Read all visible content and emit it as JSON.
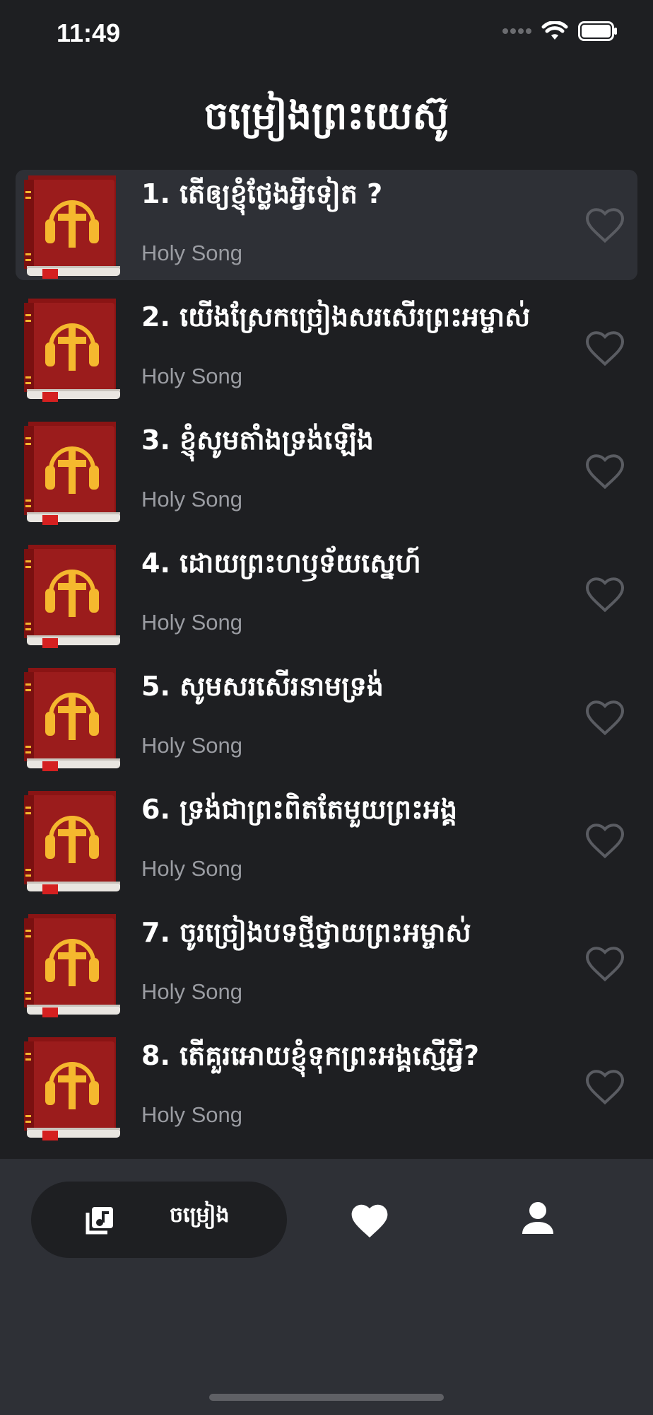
{
  "status_bar": {
    "time": "11:49"
  },
  "header": {
    "title": "ចម្រៀងព្រះយេស៊ូ"
  },
  "songs": [
    {
      "title": "1. តើឲ្យខ្ញុំថ្លែងអ្វីទៀត ?",
      "subtitle": "Holy Song",
      "favorite": false,
      "selected": true
    },
    {
      "title": "2. យើងស្រែកច្រៀងសរសើរព្រះអម្ចាស់",
      "subtitle": "Holy Song",
      "favorite": false,
      "selected": false
    },
    {
      "title": "3. ខ្ញុំសូមតាំងទ្រង់ឡើង",
      "subtitle": "Holy Song",
      "favorite": false,
      "selected": false
    },
    {
      "title": "4. ដោយព្រះហឫទ័យស្នេហ៍",
      "subtitle": "Holy Song",
      "favorite": false,
      "selected": false
    },
    {
      "title": "5. សូមសរសើរនាមទ្រង់",
      "subtitle": "Holy Song",
      "favorite": false,
      "selected": false
    },
    {
      "title": "6. ទ្រង់ជាព្រះពិតតែមួយព្រះអង្គ",
      "subtitle": "Holy Song",
      "favorite": false,
      "selected": false
    },
    {
      "title": "7. ចូរច្រៀងបទថ្មីថ្វាយព្រះអម្ចាស់",
      "subtitle": "Holy Song",
      "favorite": false,
      "selected": false
    },
    {
      "title": "8. តើគួរអោយខ្ញុំទុកព្រះអង្គស្មើអ្វី?",
      "subtitle": "Holy Song",
      "favorite": false,
      "selected": false
    }
  ],
  "tab_bar": {
    "songs_label": "ចម្រៀង",
    "active_tab": "songs",
    "icons": [
      "music-library-icon",
      "heart-icon",
      "person-icon"
    ]
  },
  "colors": {
    "background": "#1e1f22",
    "selected_row": "#2e3036",
    "tab_bar": "#2e3036",
    "subtitle": "#9a9ca2",
    "heart_outline": "#5a5c62",
    "book_red": "#9b1c1c",
    "headphone_gold": "#f5b82e"
  }
}
